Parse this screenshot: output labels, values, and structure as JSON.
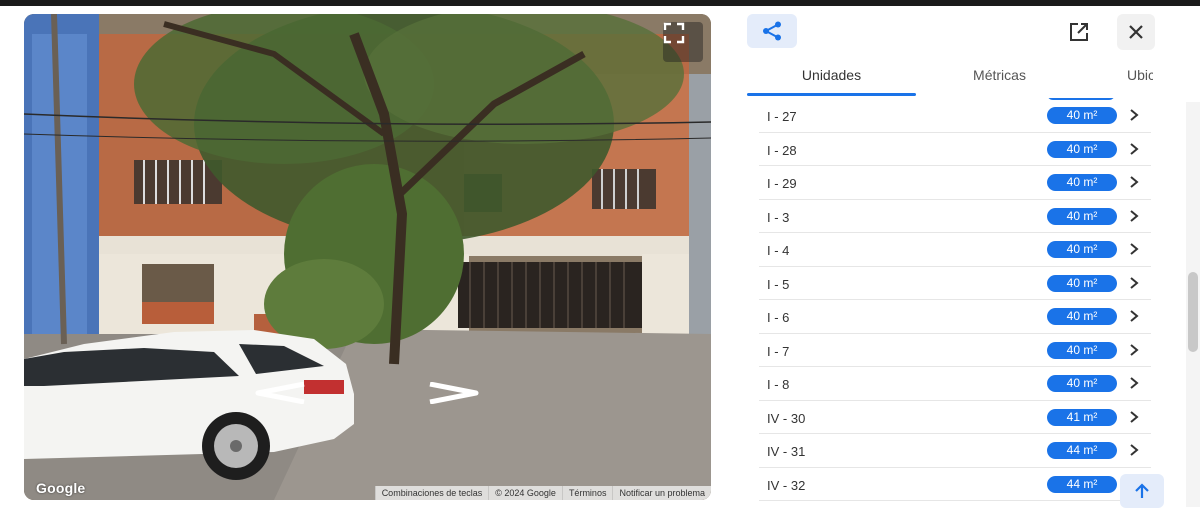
{
  "street_view": {
    "google_logo": "Google",
    "attribution": [
      "Combinaciones de teclas",
      "© 2024 Google",
      "Términos",
      "Notificar un problema"
    ],
    "icons": {
      "fullscreen": "fullscreen-icon",
      "prev": "chevron-left-icon",
      "next": "chevron-right-icon"
    }
  },
  "panel": {
    "icons": {
      "share": "share-icon",
      "open": "open-external-icon",
      "close": "close-icon",
      "scroll_top": "arrow-up-icon"
    },
    "tabs": [
      {
        "label": "Unidades",
        "active": true
      },
      {
        "label": "Métricas",
        "active": false
      },
      {
        "label": "Ubic",
        "active": false
      }
    ],
    "units": [
      {
        "label": "I - 27",
        "area": "40 m²"
      },
      {
        "label": "I - 28",
        "area": "40 m²"
      },
      {
        "label": "I - 29",
        "area": "40 m²"
      },
      {
        "label": "I - 3",
        "area": "40 m²"
      },
      {
        "label": "I - 4",
        "area": "40 m²"
      },
      {
        "label": "I - 5",
        "area": "40 m²"
      },
      {
        "label": "I - 6",
        "area": "40 m²"
      },
      {
        "label": "I - 7",
        "area": "40 m²"
      },
      {
        "label": "I - 8",
        "area": "40 m²"
      },
      {
        "label": "IV - 30",
        "area": "41 m²"
      },
      {
        "label": "IV - 31",
        "area": "44 m²"
      },
      {
        "label": "IV - 32",
        "area": "44 m²"
      }
    ]
  },
  "colors": {
    "accent": "#1a73e8",
    "accent_light": "#e4ecfa"
  }
}
